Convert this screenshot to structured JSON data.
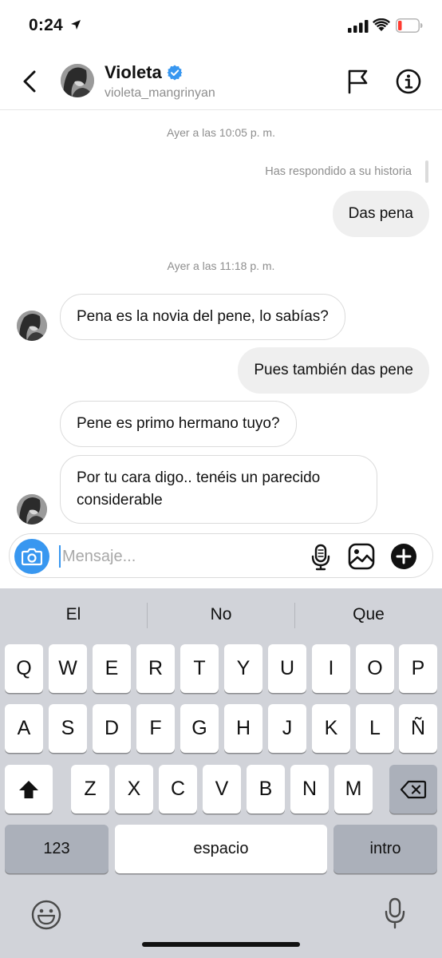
{
  "status_bar": {
    "time": "0:24",
    "battery_color": "#ff3b30"
  },
  "header": {
    "name": "Violeta",
    "username": "violeta_mangrinyan",
    "verified": true,
    "accent": "#3897f0",
    "icons": [
      "back-chevron-icon",
      "flag-icon",
      "info-icon"
    ]
  },
  "chat": {
    "timestamp_1": "Ayer a las 10:05 p. m.",
    "reply_note": "Has respondido a su historia",
    "timestamp_2": "Ayer a las 11:18 p. m.",
    "messages": [
      {
        "from": "me",
        "text": "Das pena"
      },
      {
        "from": "them",
        "text": "Pena es la novia del pene, lo sabías?"
      },
      {
        "from": "me",
        "text": "Pues también das pene"
      },
      {
        "from": "them",
        "text": "Pene es primo hermano tuyo?"
      },
      {
        "from": "them",
        "text": "Por tu cara digo.. tenéis un parecido considerable"
      }
    ]
  },
  "composer": {
    "placeholder": "Mensaje...",
    "icons": [
      "camera-icon",
      "microphone-icon",
      "gallery-icon",
      "plus-icon"
    ]
  },
  "keyboard": {
    "suggestions": [
      "El",
      "No",
      "Que"
    ],
    "row1": [
      "Q",
      "W",
      "E",
      "R",
      "T",
      "Y",
      "U",
      "I",
      "O",
      "P"
    ],
    "row2": [
      "A",
      "S",
      "D",
      "F",
      "G",
      "H",
      "J",
      "K",
      "L",
      "Ñ"
    ],
    "row3": [
      "Z",
      "X",
      "C",
      "V",
      "B",
      "N",
      "M"
    ],
    "numbers_label": "123",
    "space_label": "espacio",
    "return_label": "intro",
    "icons": [
      "shift-icon",
      "backspace-icon",
      "emoji-icon",
      "dictation-icon"
    ]
  }
}
